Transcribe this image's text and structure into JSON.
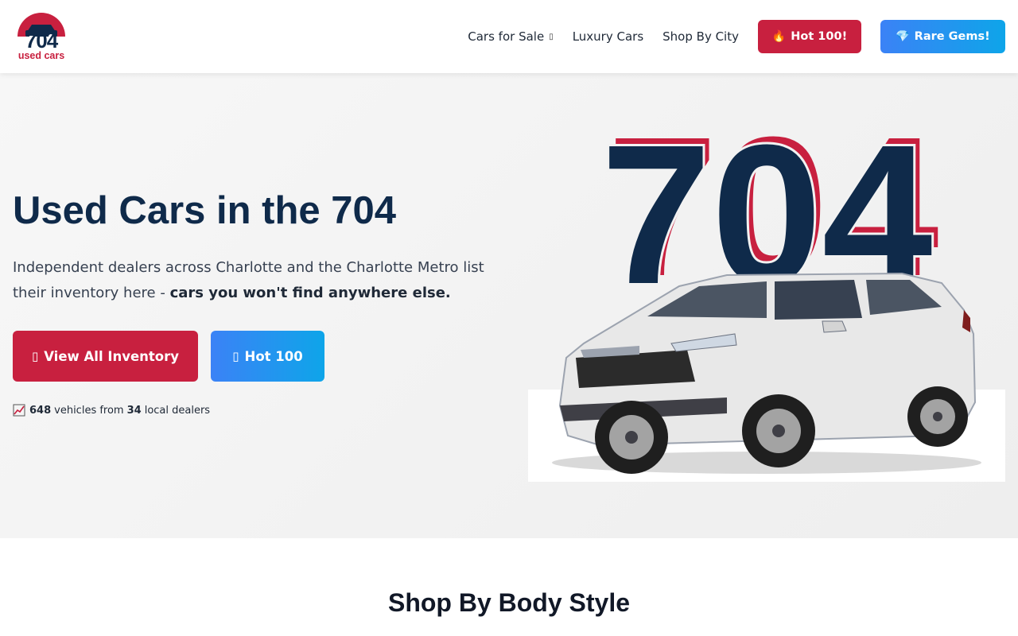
{
  "brand": {
    "logo_number": "704",
    "logo_sub": "used cars",
    "colors": {
      "navy": "#0f2a4a",
      "red": "#c8203f",
      "blue": "#3b82f6"
    }
  },
  "nav": {
    "links": [
      {
        "label": "Cars for Sale",
        "icon": "chevron-down-icon"
      },
      {
        "label": "Luxury Cars"
      },
      {
        "label": "Shop By City"
      }
    ],
    "hot_button": {
      "icon": "fire-icon",
      "icon_glyph": "🔥",
      "label": "Hot 100!"
    },
    "gems_button": {
      "icon": "gem-icon",
      "icon_glyph": "💎",
      "label": "Rare Gems!"
    }
  },
  "hero": {
    "title": "Used Cars in the 704",
    "description_prefix": "Independent dealers across Charlotte and the Charlotte Metro list their inventory here - ",
    "description_bold": "cars you won't find anywhere else.",
    "inventory_button": {
      "icon": "car-icon",
      "icon_glyph": "▯",
      "label": "View All Inventory"
    },
    "hot100_button": {
      "icon": "fire-icon",
      "icon_glyph": "▯",
      "label": "Hot 100"
    },
    "stats": {
      "icon": "chart-icon",
      "vehicles_count": "648",
      "vehicles_text": "vehicles from",
      "dealers_count": "34",
      "dealers_text": "local dealers"
    },
    "art_number": "704"
  },
  "section": {
    "title": "Shop By Body Style"
  }
}
